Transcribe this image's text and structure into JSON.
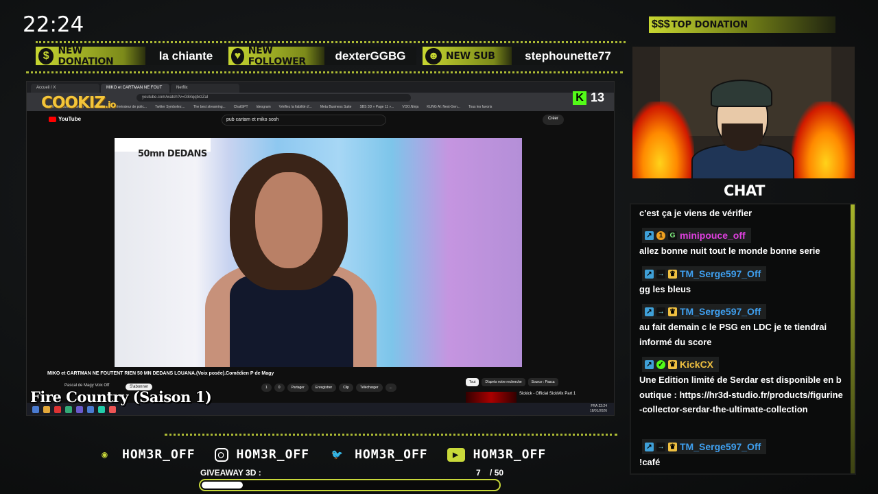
{
  "clock": "22:24",
  "alerts": {
    "donation": {
      "label": "NEW DONATION",
      "value": "la chiante",
      "icon": "dollar-icon"
    },
    "follower": {
      "label": "NEW FOLLOWER",
      "value": "dexterGGBG",
      "icon": "heart-icon"
    },
    "sub": {
      "label": "NEW SUB",
      "value": "stephounette77",
      "icon": "users-icon"
    }
  },
  "top_donation": {
    "label": "TOP DONATION",
    "icon": "$$$"
  },
  "browser": {
    "tabs": [
      "Accueil / X",
      "MIKO et CARTMAN NE FOUT",
      "Netflix"
    ],
    "url": "youtube.com/watch?v=G84qqbrzZal",
    "bookmarks": [
      "Kick",
      "Suivis - Twitch",
      "YouTube",
      "Générateur de polic...",
      "Twitter Symboles:...",
      "The best streaming...",
      "ChatGPT",
      "Ideogram",
      "Vérifiez la fiabilité d'...",
      "Meta Business Suite",
      "SBS 3D » Page 11 »...",
      "VOO.Ninja",
      "KUNG AI: Next-Gen...",
      "Tous les favoris"
    ]
  },
  "youtube": {
    "logo": "YouTube",
    "search_query": "pub cartam et miko sosh",
    "create_label": "Créer",
    "video_overlay": "50mn DEDANS",
    "video_title": "MIKO et CARTMAN NE FOUTENT RIEN 50 MN DEDANS LOUANA.(Voix posée).Comédien P de Magy",
    "channel": "Pascal de Magy Voix Off",
    "subscribe_label": "S'abonner",
    "actions": [
      "1",
      "0",
      "Partager",
      "Enregistrer",
      "Clip",
      "Télécharger",
      "..."
    ],
    "chips": [
      "Tout",
      "D'après votre recherche",
      "Source : Pasca"
    ],
    "recommended_title": "Sickick - Official SickMix Part 1"
  },
  "taskbar": {
    "lang": "FRA",
    "time": "22:24",
    "date": "18/01/2026"
  },
  "overlay": {
    "cookiz": "COOKIZ",
    "cookiz_suffix": ".io",
    "kick_count": "13",
    "series": "Fire Country (Saison 1)",
    "chat_title": "CHAT"
  },
  "chat": {
    "messages": [
      {
        "type": "text",
        "text": "c'est ça je viens de vérifier"
      },
      {
        "type": "user",
        "name": "minipouce_off",
        "color": "#e040e0"
      },
      {
        "type": "text",
        "text": "allez bonne nuit tout le monde bonne serie"
      },
      {
        "type": "user",
        "name": "TM_Serge597_Off",
        "color": "#3fa0f0"
      },
      {
        "type": "text",
        "text": "gg les bleus"
      },
      {
        "type": "user",
        "name": "TM_Serge597_Off",
        "color": "#3fa0f0"
      },
      {
        "type": "text",
        "text": "au fait demain c le PSG en LDC je te tiendrai informé du score"
      },
      {
        "type": "user",
        "name": "KickCX",
        "color": "#f0c040"
      },
      {
        "type": "text",
        "text": "Une Edition limité de Serdar est disponible en boutique : https://hr3d-studio.fr/products/figurine-collector-serdar-the-ultimate-collection"
      },
      {
        "type": "user",
        "name": "TM_Serge597_Off",
        "color": "#3fa0f0"
      },
      {
        "type": "text",
        "text": "!café"
      }
    ]
  },
  "socials": [
    {
      "icon": "discord-icon",
      "handle": "HOM3R_OFF"
    },
    {
      "icon": "instagram-icon",
      "handle": "HOM3R_OFF"
    },
    {
      "icon": "twitter-icon",
      "handle": "HOM3R_OFF"
    },
    {
      "icon": "youtube-icon",
      "handle": "HOM3R_OFF"
    }
  ],
  "giveaway": {
    "label": "GIVEAWAY 3D :",
    "current": "7",
    "total": "/ 50",
    "progress": 0.14
  },
  "colors": {
    "accent": "#c9d93a",
    "kick": "#53fc18"
  }
}
